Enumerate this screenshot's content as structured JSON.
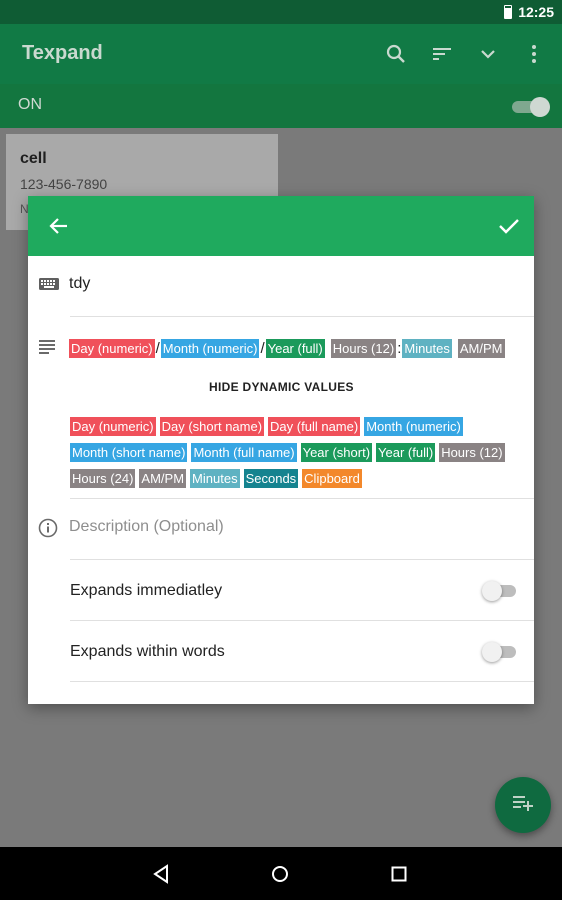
{
  "status_bar": {
    "time": "12:25"
  },
  "app_bar": {
    "title": "Texpand"
  },
  "master_toggle": {
    "label": "ON",
    "state": "on"
  },
  "background_card": {
    "name": "cell",
    "value": "123-456-7890",
    "truncated_text": "N"
  },
  "dialog": {
    "shortcut": "tdy",
    "phrase": [
      {
        "label": "Day (numeric)",
        "color": "#f0505a"
      },
      {
        "sep": "/"
      },
      {
        "label": "Month (numeric)",
        "color": "#36a6e3"
      },
      {
        "sep": "/"
      },
      {
        "label": "Year (full)",
        "color": "#1b9a5b"
      },
      {
        "sep": " "
      },
      {
        "label": "Hours (12)",
        "color": "#8a8384"
      },
      {
        "sep": ":"
      },
      {
        "label": "Minutes",
        "color": "#5fb2c2"
      },
      {
        "sep": " "
      },
      {
        "label": "AM/PM",
        "color": "#8a8384"
      }
    ],
    "hide_dynamic_values_label": "HIDE DYNAMIC VALUES",
    "dynamic_values_rows": [
      [
        {
          "label": "Day (numeric)",
          "color": "#f0505a"
        },
        {
          "label": "Day (short name)",
          "color": "#f0505a"
        },
        {
          "label": "Day (full name)",
          "color": "#f0505a"
        },
        {
          "label": "Month (numeric)",
          "color": "#36a6e3"
        }
      ],
      [
        {
          "label": "Month (short name)",
          "color": "#36a6e3"
        },
        {
          "label": "Month (full name)",
          "color": "#36a6e3"
        },
        {
          "label": "Year (short)",
          "color": "#1b9a5b"
        },
        {
          "label": "Year (full)",
          "color": "#1b9a5b"
        },
        {
          "label": "Hours (12)",
          "color": "#8a8384"
        }
      ],
      [
        {
          "label": "Hours (24)",
          "color": "#8a8384"
        },
        {
          "label": "AM/PM",
          "color": "#8a8384"
        },
        {
          "label": "Minutes",
          "color": "#5fb2c2"
        },
        {
          "label": "Seconds",
          "color": "#15838f"
        },
        {
          "label": "Clipboard",
          "color": "#f3882b"
        }
      ]
    ],
    "description_placeholder": "Description (Optional)",
    "expands_immediately": {
      "label": "Expands immediatley",
      "state": "off"
    },
    "expands_within_words": {
      "label": "Expands within words",
      "state": "off"
    }
  },
  "colors": {
    "header_green": "#1faa5e",
    "app_bar_green": "#117a45"
  }
}
